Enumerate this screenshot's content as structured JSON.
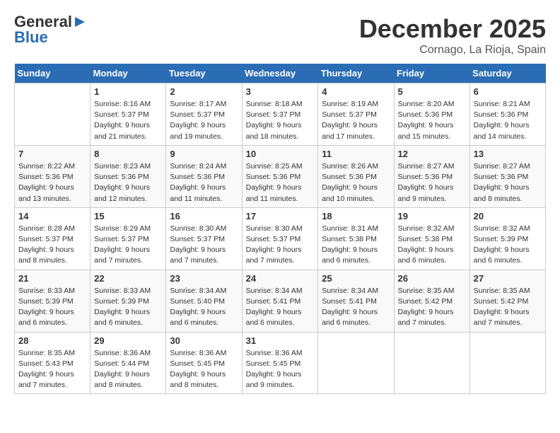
{
  "logo": {
    "general": "General",
    "blue": "Blue"
  },
  "title": {
    "month": "December 2025",
    "location": "Cornago, La Rioja, Spain"
  },
  "weekdays": [
    "Sunday",
    "Monday",
    "Tuesday",
    "Wednesday",
    "Thursday",
    "Friday",
    "Saturday"
  ],
  "weeks": [
    [
      {
        "day": "",
        "info": ""
      },
      {
        "day": "1",
        "info": "Sunrise: 8:16 AM\nSunset: 5:37 PM\nDaylight: 9 hours\nand 21 minutes."
      },
      {
        "day": "2",
        "info": "Sunrise: 8:17 AM\nSunset: 5:37 PM\nDaylight: 9 hours\nand 19 minutes."
      },
      {
        "day": "3",
        "info": "Sunrise: 8:18 AM\nSunset: 5:37 PM\nDaylight: 9 hours\nand 18 minutes."
      },
      {
        "day": "4",
        "info": "Sunrise: 8:19 AM\nSunset: 5:37 PM\nDaylight: 9 hours\nand 17 minutes."
      },
      {
        "day": "5",
        "info": "Sunrise: 8:20 AM\nSunset: 5:36 PM\nDaylight: 9 hours\nand 15 minutes."
      },
      {
        "day": "6",
        "info": "Sunrise: 8:21 AM\nSunset: 5:36 PM\nDaylight: 9 hours\nand 14 minutes."
      }
    ],
    [
      {
        "day": "7",
        "info": "Sunrise: 8:22 AM\nSunset: 5:36 PM\nDaylight: 9 hours\nand 13 minutes."
      },
      {
        "day": "8",
        "info": "Sunrise: 8:23 AM\nSunset: 5:36 PM\nDaylight: 9 hours\nand 12 minutes."
      },
      {
        "day": "9",
        "info": "Sunrise: 8:24 AM\nSunset: 5:36 PM\nDaylight: 9 hours\nand 11 minutes."
      },
      {
        "day": "10",
        "info": "Sunrise: 8:25 AM\nSunset: 5:36 PM\nDaylight: 9 hours\nand 11 minutes."
      },
      {
        "day": "11",
        "info": "Sunrise: 8:26 AM\nSunset: 5:36 PM\nDaylight: 9 hours\nand 10 minutes."
      },
      {
        "day": "12",
        "info": "Sunrise: 8:27 AM\nSunset: 5:36 PM\nDaylight: 9 hours\nand 9 minutes."
      },
      {
        "day": "13",
        "info": "Sunrise: 8:27 AM\nSunset: 5:36 PM\nDaylight: 9 hours\nand 8 minutes."
      }
    ],
    [
      {
        "day": "14",
        "info": "Sunrise: 8:28 AM\nSunset: 5:37 PM\nDaylight: 9 hours\nand 8 minutes."
      },
      {
        "day": "15",
        "info": "Sunrise: 8:29 AM\nSunset: 5:37 PM\nDaylight: 9 hours\nand 7 minutes."
      },
      {
        "day": "16",
        "info": "Sunrise: 8:30 AM\nSunset: 5:37 PM\nDaylight: 9 hours\nand 7 minutes."
      },
      {
        "day": "17",
        "info": "Sunrise: 8:30 AM\nSunset: 5:37 PM\nDaylight: 9 hours\nand 7 minutes."
      },
      {
        "day": "18",
        "info": "Sunrise: 8:31 AM\nSunset: 5:38 PM\nDaylight: 9 hours\nand 6 minutes."
      },
      {
        "day": "19",
        "info": "Sunrise: 8:32 AM\nSunset: 5:38 PM\nDaylight: 9 hours\nand 6 minutes."
      },
      {
        "day": "20",
        "info": "Sunrise: 8:32 AM\nSunset: 5:39 PM\nDaylight: 9 hours\nand 6 minutes."
      }
    ],
    [
      {
        "day": "21",
        "info": "Sunrise: 8:33 AM\nSunset: 5:39 PM\nDaylight: 9 hours\nand 6 minutes."
      },
      {
        "day": "22",
        "info": "Sunrise: 8:33 AM\nSunset: 5:39 PM\nDaylight: 9 hours\nand 6 minutes."
      },
      {
        "day": "23",
        "info": "Sunrise: 8:34 AM\nSunset: 5:40 PM\nDaylight: 9 hours\nand 6 minutes."
      },
      {
        "day": "24",
        "info": "Sunrise: 8:34 AM\nSunset: 5:41 PM\nDaylight: 9 hours\nand 6 minutes."
      },
      {
        "day": "25",
        "info": "Sunrise: 8:34 AM\nSunset: 5:41 PM\nDaylight: 9 hours\nand 6 minutes."
      },
      {
        "day": "26",
        "info": "Sunrise: 8:35 AM\nSunset: 5:42 PM\nDaylight: 9 hours\nand 7 minutes."
      },
      {
        "day": "27",
        "info": "Sunrise: 8:35 AM\nSunset: 5:42 PM\nDaylight: 9 hours\nand 7 minutes."
      }
    ],
    [
      {
        "day": "28",
        "info": "Sunrise: 8:35 AM\nSunset: 5:43 PM\nDaylight: 9 hours\nand 7 minutes."
      },
      {
        "day": "29",
        "info": "Sunrise: 8:36 AM\nSunset: 5:44 PM\nDaylight: 9 hours\nand 8 minutes."
      },
      {
        "day": "30",
        "info": "Sunrise: 8:36 AM\nSunset: 5:45 PM\nDaylight: 9 hours\nand 8 minutes."
      },
      {
        "day": "31",
        "info": "Sunrise: 8:36 AM\nSunset: 5:45 PM\nDaylight: 9 hours\nand 9 minutes."
      },
      {
        "day": "",
        "info": ""
      },
      {
        "day": "",
        "info": ""
      },
      {
        "day": "",
        "info": ""
      }
    ]
  ]
}
